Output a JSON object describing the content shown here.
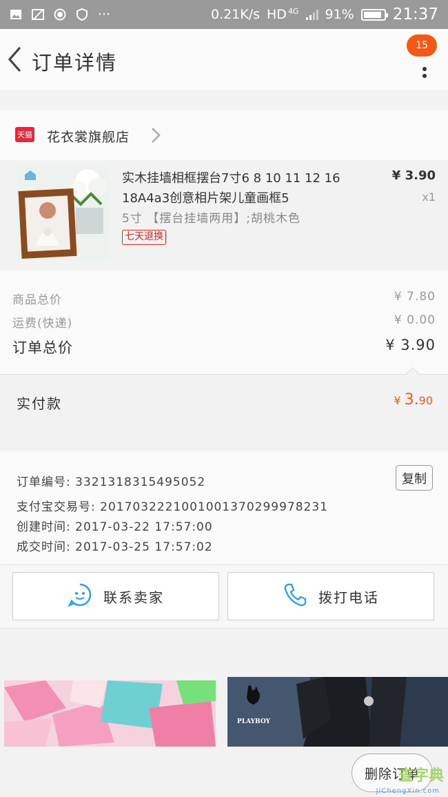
{
  "status_bar": {
    "net_speed": "0.21K/s",
    "hd": "HD",
    "net_type": "4G",
    "battery": "91%",
    "battery_level": 0.91,
    "time": "21:37"
  },
  "header": {
    "title": "订单详情",
    "badge_count": "15"
  },
  "shop": {
    "logo_text": "天猫",
    "name": "花衣裳旗舰店"
  },
  "product": {
    "name": "实木挂墙相框摆台7寸6 8 10 11 12 16 18A4a3创意相片架儿童画框5",
    "spec": "5寸 【摆台挂墙两用】;胡桃木色",
    "tag": "七天退换",
    "price": "¥ 3.90",
    "qty": "x1"
  },
  "prices": {
    "goods_label": "商品总价",
    "goods_value": "¥ 7.80",
    "shipping_label": "运费(快递)",
    "shipping_value": "¥ 0.00",
    "total_label": "订单总价",
    "total_value": "¥ 3.90"
  },
  "paid": {
    "label": "实付款",
    "currency": "¥",
    "int_part": "3.",
    "dec_part": "90"
  },
  "order_info": {
    "order_no": "订单编号: 3321318315495052",
    "alipay_no": "支付宝交易号: 2017032221001001370299978231",
    "created": "创建时间: 2017-03-22 17:57:00",
    "closed": "成交时间: 2017-03-25 17:57:02",
    "copy_label": "复制"
  },
  "actions": {
    "contact_seller": "联系卖家",
    "call_phone": "拨打电话"
  },
  "recs": {
    "brand_text": "PLAYBOY"
  },
  "footer": {
    "delete_label": "删除订单",
    "watermark": "查字典",
    "watermark_url": "JiChengXin.com"
  }
}
